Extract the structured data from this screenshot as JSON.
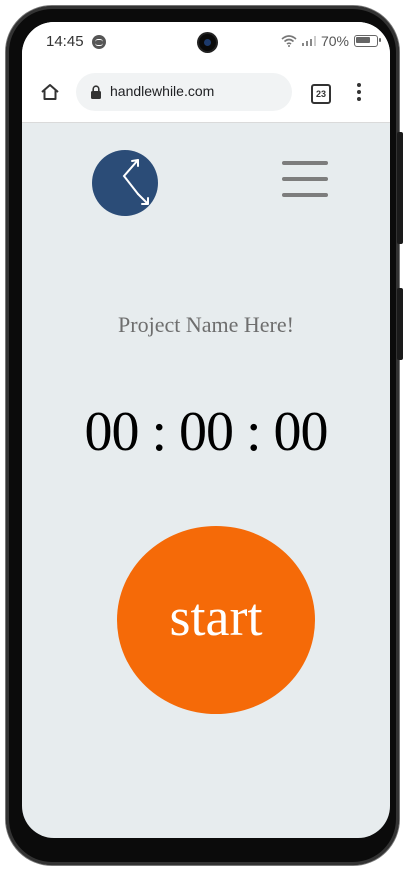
{
  "status": {
    "time": "14:45",
    "battery": "70%"
  },
  "browser": {
    "url": "handlewhile.com",
    "tab_count": "23"
  },
  "page": {
    "project_name": "Project Name Here!",
    "timer": "00 : 00 : 00",
    "start_label": "start"
  },
  "colors": {
    "logo": "#2b4c77",
    "start_button": "#f56a08",
    "page_background": "#e7ecee"
  }
}
